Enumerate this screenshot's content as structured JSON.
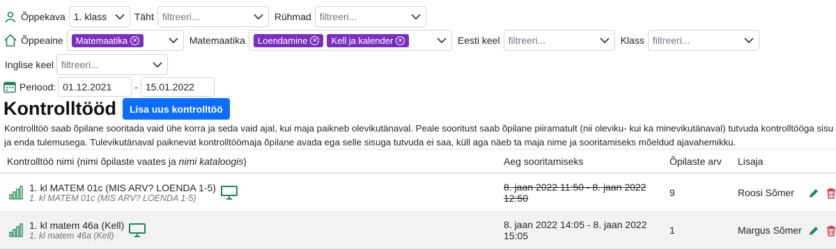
{
  "filters": {
    "oppekava_label": "Õppekava",
    "oppekava_value": "1. klass",
    "taht_label": "Täht",
    "taht_placeholder": "filtreeri...",
    "ruhmad_label": "Rühmad",
    "ruhmad_placeholder": "filtreeri...",
    "oppeaine_label": "Õppeaine",
    "oppeaine_chips": [
      "Matemaatika"
    ],
    "matemaatika_label": "Matemaatika",
    "matemaatika_chips": [
      "Loendamine",
      "Kell ja kalender"
    ],
    "eesti_keel_label": "Eesti keel",
    "eesti_keel_placeholder": "filtreeri...",
    "klass_label": "Klass",
    "klass_placeholder": "filtreeri...",
    "inglise_keel_label": "Inglise keel",
    "inglise_keel_placeholder": "filtreeri...",
    "periood_label": "Periood:",
    "periood_start": "01.12.2021",
    "periood_sep": "-",
    "periood_end": "15.01.2022"
  },
  "header": {
    "title": "Kontrolltööd",
    "add_button": "Lisa uus kontrolltöö"
  },
  "description": "Kontrolltöö saab õpilane sooritada vaid ühe korra ja seda vaid ajal, kui maja paikneb olevikutänaval. Peale sooritust saab õpilane piiramatult (nii oleviku- kui ka minevikutänaval) tutvuda kontrolltööga sisu ja enda tulemusega. Tulevikutänaval paiknevat kontrolltöömaja õpilane avada ega selle sisuga tutvuda ei saa, küll aga näeb ta maja nime ja sooritamiseks mõeldud ajavahemikku.",
  "table": {
    "col_name_prefix": "Kontrolltöö nimi (nimi õpilaste vaates ja ",
    "col_name_italic": "nimi kataloogis",
    "col_name_suffix": ")",
    "col_time": "Aeg sooritamiseks",
    "col_students": "Õpilaste arv",
    "col_author": "Lisaja",
    "rows": [
      {
        "name": "1. kl MATEM 01c (MIS ARV? LOENDA 1-5)",
        "catalog": "1. kl MATEM 01c (MIS ARV? LOENDA 1-5)",
        "time": "8. jaan 2022 11:50 - 8. jaan 2022 12:50",
        "expired": true,
        "students": "9",
        "author": "Roosi Sõmer"
      },
      {
        "name": "1. kl matem 46a (Kell)",
        "catalog": "1. kl matem 46a (Kell)",
        "time": "8. jaan 2022 14:05 - 8. jaan 2022 15:05",
        "expired": false,
        "students": "1",
        "author": "Margus Sõmer"
      }
    ]
  },
  "colors": {
    "chip": "#7a2fbf",
    "button": "#0d6efd",
    "green": "#198754",
    "red": "#dc3545"
  }
}
